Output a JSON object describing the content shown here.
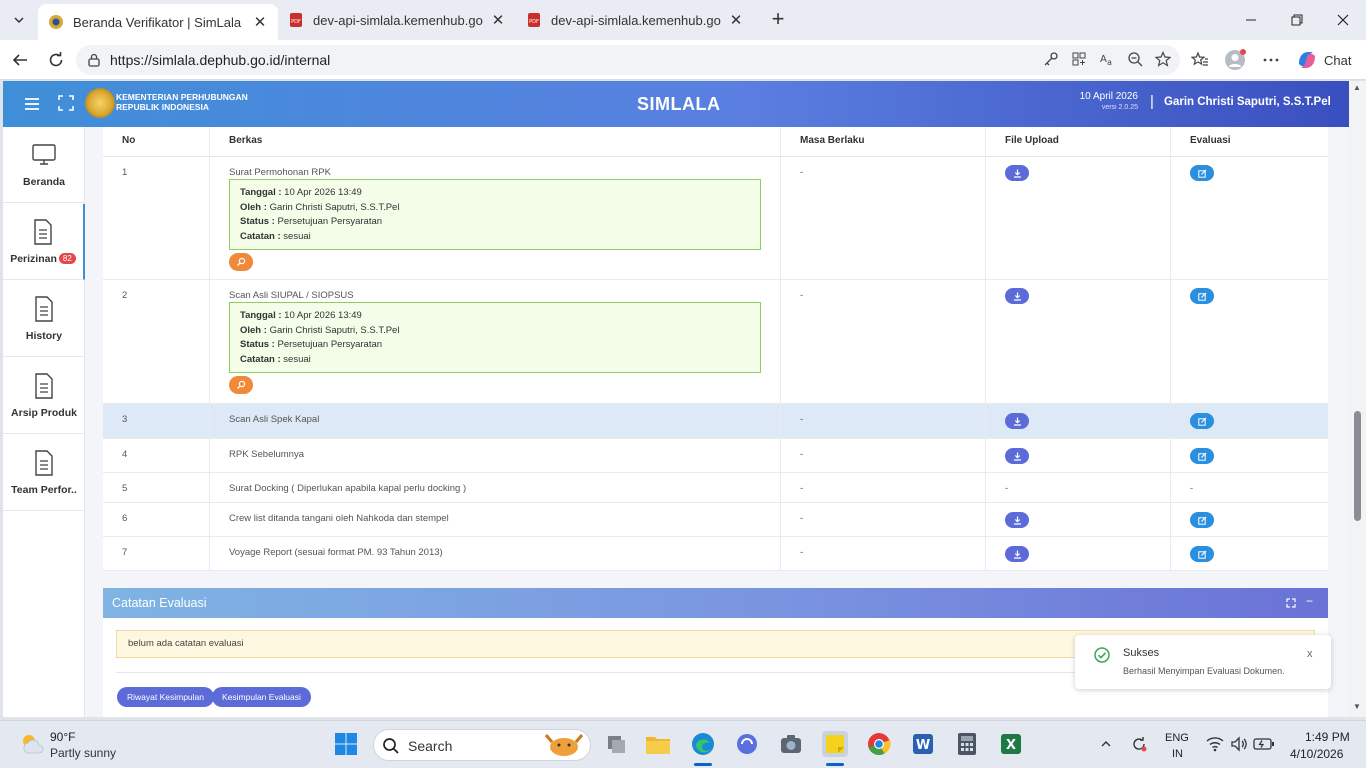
{
  "browser": {
    "tabs": [
      {
        "title": "Beranda Verifikator | SimLala",
        "active": true
      },
      {
        "title": "dev-api-simlala.kemenhub.go.id/a",
        "active": false
      },
      {
        "title": "dev-api-simlala.kemenhub.go.id/a",
        "active": false
      }
    ],
    "url": "https://simlala.dephub.go.id/internal",
    "chat_label": "Chat"
  },
  "header": {
    "org_line1": "KEMENTERIAN PERHUBUNGAN",
    "org_line2": "REPUBLIK INDONESIA",
    "app_title": "SIMLALA",
    "date": "10 April 2026",
    "version": "versi 2.0.25",
    "separator": "|",
    "user": "Garin Christi Saputri, S.S.T.Pel"
  },
  "sidebar": {
    "items": [
      {
        "label": "Beranda",
        "icon": "monitor-icon"
      },
      {
        "label": "Perizinan",
        "icon": "document-icon",
        "badge": "82"
      },
      {
        "label": "History",
        "icon": "document-icon"
      },
      {
        "label": "Arsip Produk",
        "icon": "document-icon"
      },
      {
        "label": "Team Perfor..",
        "icon": "document-icon"
      }
    ]
  },
  "table": {
    "headers": [
      "No",
      "Berkas",
      "Masa Berlaku",
      "File Upload",
      "Evaluasi"
    ],
    "info_labels": {
      "tanggal": "Tanggal :",
      "oleh": "Oleh :",
      "status": "Status :",
      "catatan": "Catatan :"
    },
    "rows": [
      {
        "no": "1",
        "berkas": "Surat Permohonan RPK",
        "masa": "-",
        "tanggal": "10 Apr 2026 13:49",
        "oleh": "Garin Christi Saputri, S.S.T.Pel",
        "status": "Persetujuan Persyaratan",
        "catatan": "sesuai"
      },
      {
        "no": "2",
        "berkas": "Scan Asli SIUPAL / SIOPSUS",
        "masa": "-",
        "tanggal": "10 Apr 2026 13:49",
        "oleh": "Garin Christi Saputri, S.S.T.Pel",
        "status": "Persetujuan Persyaratan",
        "catatan": "sesuai"
      },
      {
        "no": "3",
        "berkas": "Scan Asli Spek Kapal",
        "masa": "-"
      },
      {
        "no": "4",
        "berkas": "RPK Sebelumnya",
        "masa": "-"
      },
      {
        "no": "5",
        "berkas": "Surat Docking ( Diperlukan apabila kapal perlu docking )",
        "masa": "-",
        "upload": "-",
        "evaluasi": "-"
      },
      {
        "no": "6",
        "berkas": "Crew list ditanda tangani oleh Nahkoda dan stempel",
        "masa": "-"
      },
      {
        "no": "7",
        "berkas": "Voyage Report (sesuai format PM. 93 Tahun 2013)",
        "masa": "-"
      }
    ]
  },
  "evaluation": {
    "title": "Catatan Evaluasi",
    "note": "belum ada catatan evaluasi",
    "btn_history": "Riwayat Kesimpulan",
    "btn_conclusion": "Kesimpulan Evaluasi"
  },
  "toast": {
    "title": "Sukses",
    "message": "Berhasil Menyimpan Evaluasi Dokumen.",
    "close": "x"
  },
  "taskbar": {
    "temperature": "90°F",
    "weather": "Partly sunny",
    "search_placeholder": "Search",
    "lang_line1": "ENG",
    "lang_line2": "IN",
    "time": "1:49 PM",
    "date": "4/10/2026"
  },
  "colors": {
    "header_start": "#3f8fd8",
    "header_end": "#3a4fbf",
    "download_button": "#5c6bd8",
    "evaluate_button": "#2b8fe0",
    "zoom_button": "#f0893a",
    "info_box_bg": "#f3fde8",
    "info_box_border": "#8bd05e",
    "badge": "#e5484d"
  }
}
